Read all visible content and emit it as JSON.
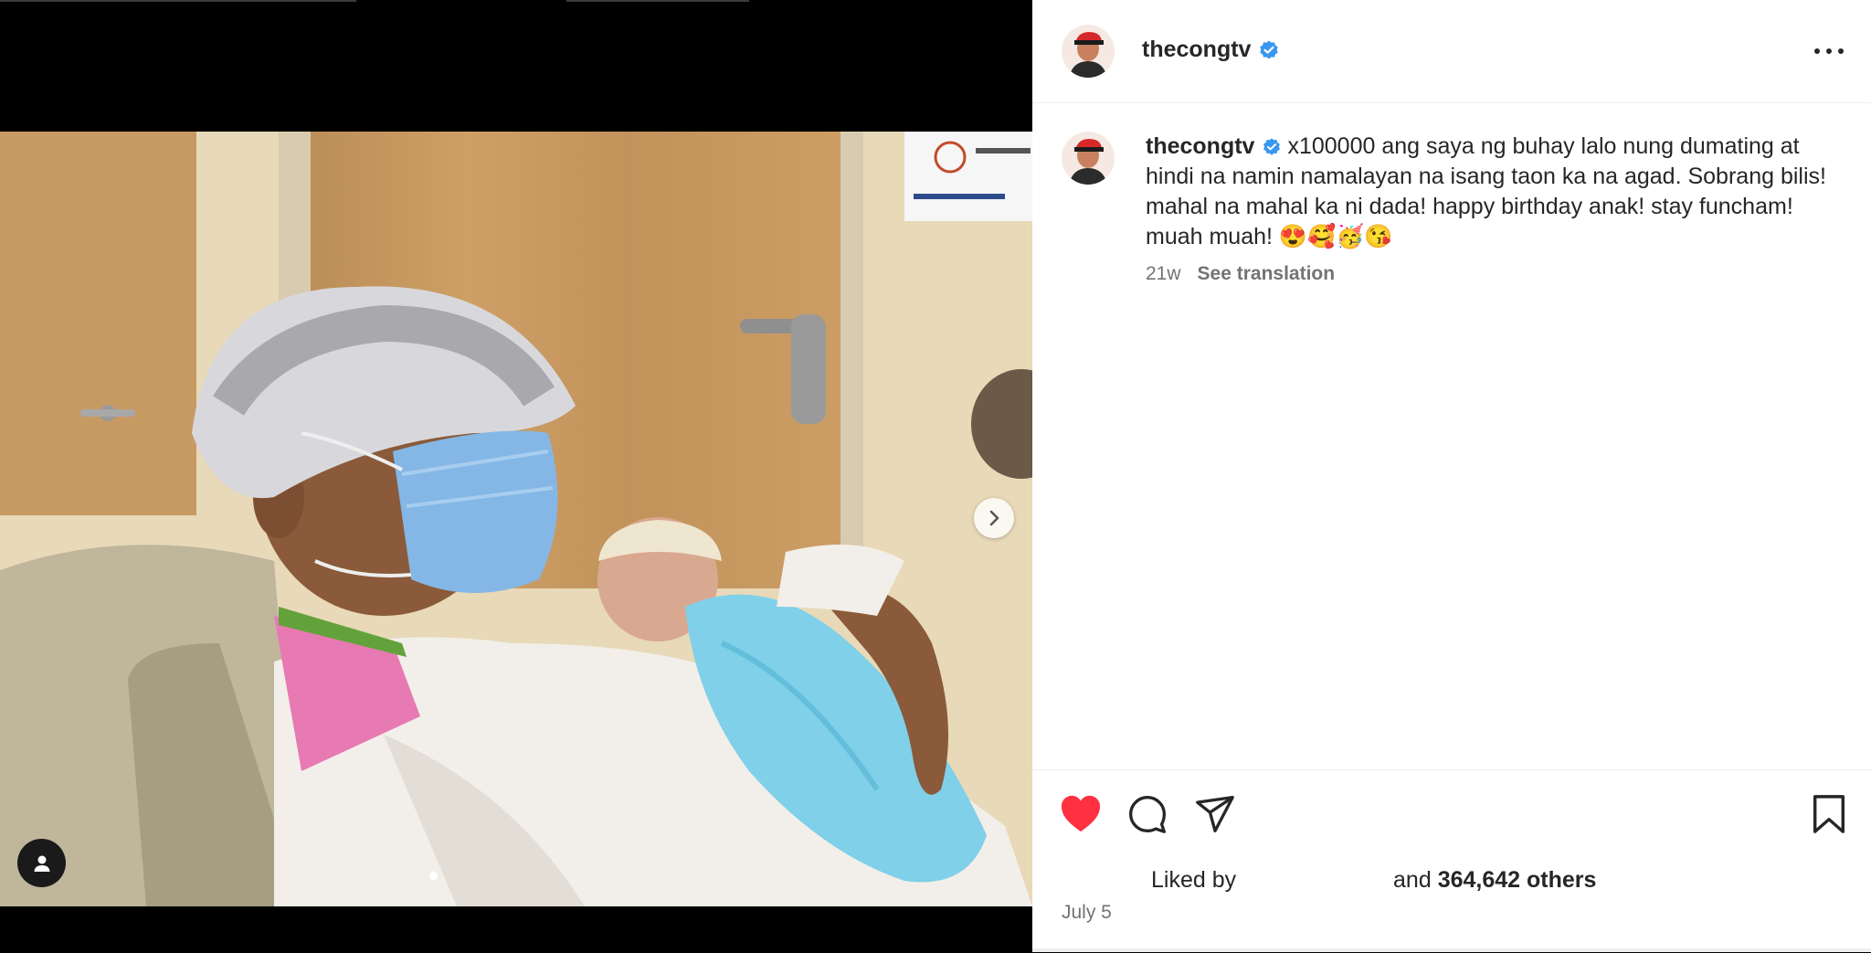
{
  "post": {
    "username": "thecongtv",
    "verified": true,
    "caption_text": "x100000 ang saya ng buhay lalo nung dumating at hindi na namin namalayan na isang taon ka na agad. Sobrang bilis! mahal na mahal ka ni dada! happy birthday anak! stay funcham! muah muah! 😍🥰🥳😘",
    "age": "21w",
    "see_translation": "See translation",
    "liked_by_prefix": "Liked by",
    "liked_by_and": "and",
    "likes_count": "364,642 others",
    "date": "July 5"
  },
  "media": {
    "carousel_count": 1,
    "active_index": 0
  },
  "icons": {
    "like": "heart-filled-icon",
    "comment": "comment-icon",
    "share": "paper-plane-icon",
    "save": "bookmark-icon",
    "more": "more-horizontal-icon",
    "next": "chevron-right-icon",
    "tag": "user-tag-icon"
  },
  "colors": {
    "like_red": "#ff3040",
    "verified_blue": "#3897f0",
    "text_primary": "#262626",
    "text_secondary": "#737373"
  }
}
